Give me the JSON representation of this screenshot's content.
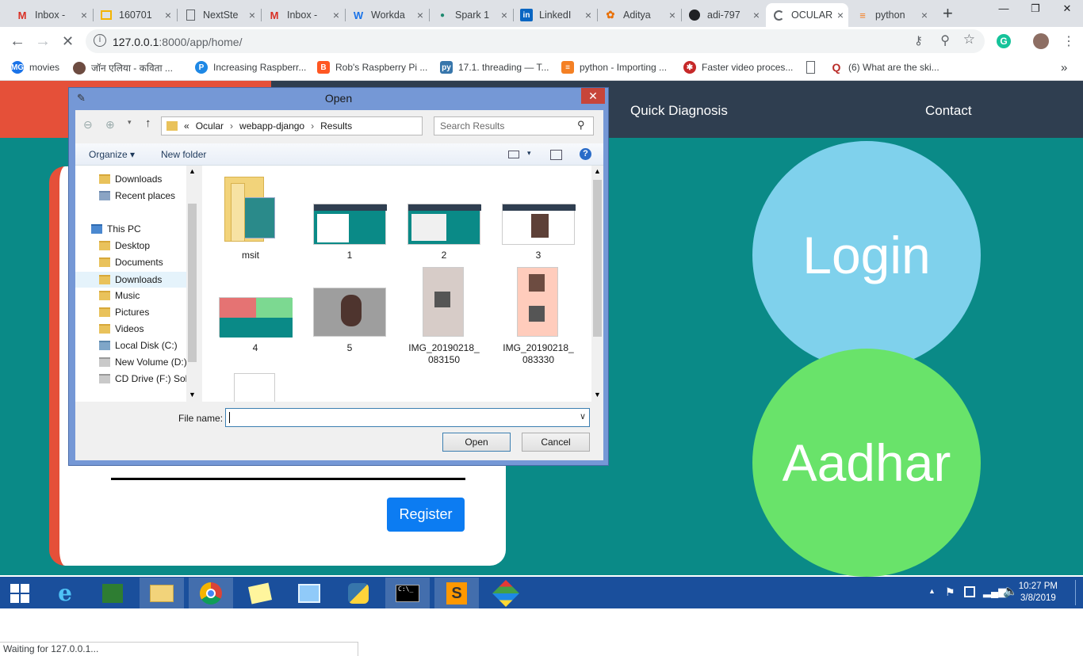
{
  "browser": {
    "tabs": [
      {
        "label": "Inbox - ",
        "icon": "gmail-icon"
      },
      {
        "label": "160701",
        "icon": "slides-icon"
      },
      {
        "label": "NextSte",
        "icon": "doc-icon"
      },
      {
        "label": "Inbox - ",
        "icon": "gmail-icon"
      },
      {
        "label": "Workda",
        "icon": "workday-icon"
      },
      {
        "label": "Spark 1",
        "icon": "spark-icon"
      },
      {
        "label": "LinkedI",
        "icon": "linkedin-icon"
      },
      {
        "label": "Aditya ",
        "icon": "stack-icon"
      },
      {
        "label": "adi-797",
        "icon": "github-icon"
      },
      {
        "label": "OCULAR",
        "icon": "loading-icon"
      },
      {
        "label": "python",
        "icon": "stackoverflow-icon"
      }
    ],
    "new_tab": "+",
    "url_host": "127.0.0.1",
    "url_path": ":8000/app/home/",
    "bookmarks": [
      {
        "label": "movies"
      },
      {
        "label": "जॉन एलिया - कविता ..."
      },
      {
        "label": "Increasing Raspberr..."
      },
      {
        "label": "Rob's Raspberry Pi ..."
      },
      {
        "label": "17.1. threading — T..."
      },
      {
        "label": "python - Importing ..."
      },
      {
        "label": "Faster video proces..."
      },
      {
        "label": ""
      },
      {
        "label": "(6) What are the ski..."
      }
    ],
    "more_bookmarks": "»",
    "status_text": "Waiting for 127.0.0.1..."
  },
  "page": {
    "nav_quick_diagnosis": "Quick Diagnosis",
    "nav_contact": "Contact",
    "login_label": "Login",
    "aadhar_label": "Aadhar",
    "register_label": "Register"
  },
  "dialog": {
    "title": "Open",
    "close": "✕",
    "breadcrumb": [
      "«",
      "Ocular",
      "webapp-django",
      "Results"
    ],
    "search_placeholder": "Search Results",
    "organize_label": "Organize ▾",
    "new_folder_label": "New folder",
    "nav_items": [
      {
        "label": "Downloads"
      },
      {
        "label": "Recent places"
      },
      {
        "label": "This PC"
      },
      {
        "label": "Desktop"
      },
      {
        "label": "Documents"
      },
      {
        "label": "Downloads"
      },
      {
        "label": "Music"
      },
      {
        "label": "Pictures"
      },
      {
        "label": "Videos"
      },
      {
        "label": "Local Disk (C:)"
      },
      {
        "label": "New Volume (D:)"
      },
      {
        "label": "CD Drive (F:) Soli"
      }
    ],
    "files": [
      {
        "name": "msit"
      },
      {
        "name": "1"
      },
      {
        "name": "2"
      },
      {
        "name": "3"
      },
      {
        "name": "4"
      },
      {
        "name": "5"
      },
      {
        "name": "IMG_20190218_083150"
      },
      {
        "name": "IMG_20190218_083330"
      }
    ],
    "file_name_label": "File name:",
    "file_name_value": "",
    "open_button": "Open",
    "cancel_button": "Cancel"
  },
  "taskbar": {
    "time": "10:27 PM",
    "date": "3/8/2019"
  }
}
